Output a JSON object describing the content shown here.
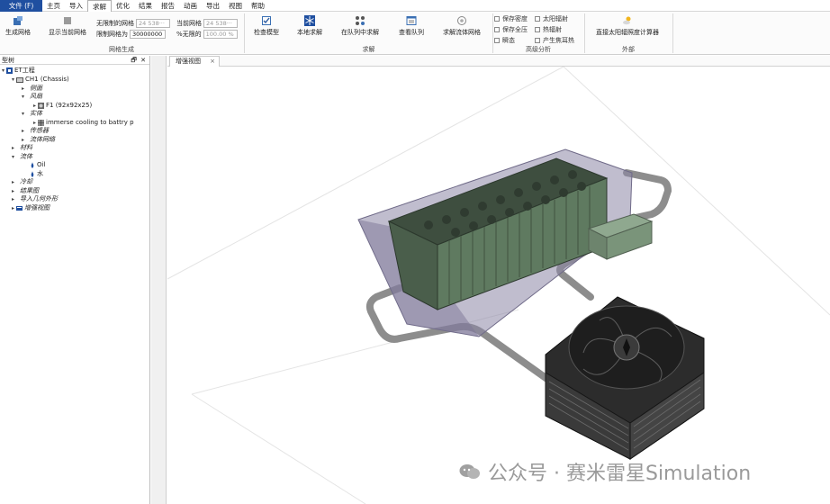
{
  "menubar": {
    "items": [
      "文件 (F)",
      "主页",
      "导入",
      "求解",
      "优化",
      "结果",
      "报告",
      "动画",
      "导出",
      "视图",
      "帮助"
    ]
  },
  "ribbon": {
    "mesh_group": {
      "generate_mesh": "生成网格",
      "show_current_mesh": "显示当前网格",
      "unlimited_mesh_label": "无限制的网格",
      "unlimited_mesh_value": "24 538···",
      "current_mesh_label": "当前网格",
      "current_mesh_value": "24 538···",
      "limit_mesh_label": "限制网格为",
      "limit_mesh_value": "30000000",
      "unlimited_pct_label": "%无限的",
      "unlimited_pct_value": "100.00 %",
      "group_label": "网格生成"
    },
    "solve_group": {
      "check_model": "检查模型",
      "local_solve": "本地求解",
      "queue_solve": "在队列中求解",
      "view_queue": "查看队列",
      "solve_fluid_mesh": "求解流体网格",
      "group_label": "求解"
    },
    "advanced_group": {
      "keep_density": "保存密度",
      "keep_full_pressure": "保存全压",
      "log": "瞬态",
      "solar_radiation": "太阳辐射",
      "thermal_radiation": "热辐射",
      "produce_focus_heat": "产生焦耳热",
      "group_label": "高级分析"
    },
    "external_group": {
      "direct_solar_calc": "直接太阳辐照度计算器",
      "group_label": "外部"
    }
  },
  "tree_panel": {
    "title": "型树",
    "controls": "🗗 ✕",
    "rows": [
      {
        "label": "ET工程",
        "twisty": "▾",
        "icon": "project-icon"
      },
      {
        "label": "CH1 (Chassis)",
        "twisty": "▾",
        "icon": "chassis-icon"
      },
      {
        "label": "侧面",
        "twisty": "▸",
        "icon": ""
      },
      {
        "label": "风扇",
        "twisty": "▾",
        "icon": ""
      },
      {
        "label": "F1 (92x92x25)",
        "twisty": "▸",
        "icon": "fan-icon"
      },
      {
        "label": "实体",
        "twisty": "▾",
        "icon": ""
      },
      {
        "label": "immerse cooling to battry p",
        "twisty": "▸",
        "icon": "solid-icon"
      },
      {
        "label": "传感器",
        "twisty": "▸",
        "icon": ""
      },
      {
        "label": "流体网络",
        "twisty": "▸",
        "icon": ""
      },
      {
        "label": "材料",
        "twisty": "▸",
        "icon": ""
      },
      {
        "label": "流体",
        "twisty": "▾",
        "icon": ""
      },
      {
        "label": "Oil",
        "twisty": "",
        "icon": "drop-icon"
      },
      {
        "label": "水",
        "twisty": "",
        "icon": "drop-icon"
      },
      {
        "label": "冷却",
        "twisty": "▸",
        "icon": ""
      },
      {
        "label": "结果图",
        "twisty": "▸",
        "icon": ""
      },
      {
        "label": "导入几何外形",
        "twisty": "▸",
        "icon": ""
      },
      {
        "label": "增强视图",
        "twisty": "▸",
        "icon": "view-icon"
      }
    ]
  },
  "viewport": {
    "tab_label": "增强视图",
    "tab_close": "×"
  },
  "watermark": "公众号 · 赛米雷星Simulation",
  "colors": {
    "file_menu_bg": "#1f4fa0",
    "battery_green": "#5f7a60",
    "tank_purple": "#8c86a6",
    "pipe_gray": "#8d8d8d",
    "radiator_dark": "#2c2c2c"
  }
}
